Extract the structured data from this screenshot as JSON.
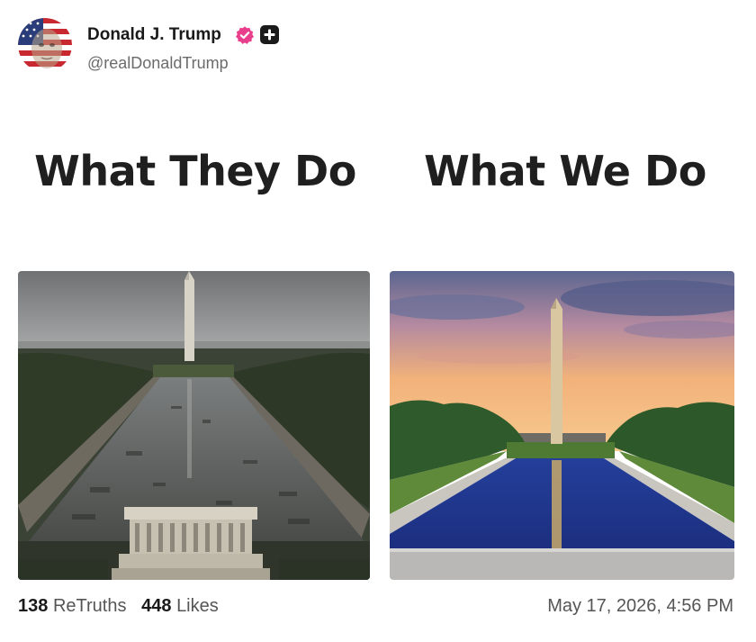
{
  "post": {
    "author_name": "Donald J. Trump",
    "handle": "@realDonaldTrump",
    "heading_left": "What They Do",
    "heading_right": "What We Do",
    "retruths_count": "138",
    "retruths_label": "ReTruths",
    "likes_count": "448",
    "likes_label": "Likes",
    "timestamp": "May 17, 2026, 4:56 PM"
  },
  "icons": {
    "avatar": "avatar-flag-face",
    "verified": "verified-badge-icon",
    "plus": "plus-icon"
  },
  "colors": {
    "verified_badge": "#e83e8c",
    "text_primary": "#1a1a1a",
    "text_secondary": "#6b6b6b"
  },
  "images": {
    "left": "polluted-reflecting-pool-photo",
    "right": "clean-reflecting-pool-sunset-photo"
  }
}
